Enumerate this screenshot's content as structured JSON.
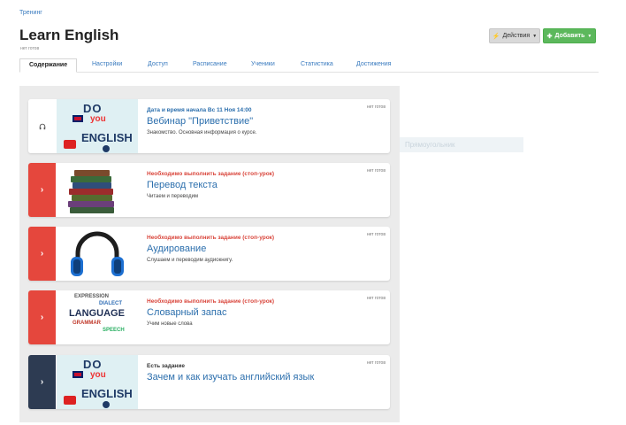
{
  "breadcrumb": "Тренинг",
  "page": {
    "title": "Learn English",
    "status": "нет готов"
  },
  "actions": {
    "actions_label": "Действия",
    "add_label": "Добавить"
  },
  "tabs": [
    {
      "label": "Содержание",
      "active": true
    },
    {
      "label": "Настройки"
    },
    {
      "label": "Доступ"
    },
    {
      "label": "Расписание"
    },
    {
      "label": "Ученики"
    },
    {
      "label": "Статистика"
    },
    {
      "label": "Достижения"
    }
  ],
  "tooltip": "Прямоугольник",
  "lessons": [
    {
      "meta": "Дата и время начала Вс 11 Ноя 14:00",
      "title": "Вебинар \"Приветствие\"",
      "desc": "Знакомство. Основная информация о курсе.",
      "status": "нет готов",
      "side": "plain",
      "thumb": "do-you-speak-english"
    },
    {
      "meta": "Необходимо выполнить задание (стоп-урок)",
      "title": "Перевод текста",
      "desc": "Читаем и переводим",
      "status": "нет готов",
      "side": "red",
      "thumb": "books"
    },
    {
      "meta": "Необходимо выполнить задание (стоп-урок)",
      "title": "Аудирование",
      "desc": "Слушаем и переводим аудиокнигу.",
      "status": "нет готов",
      "side": "red",
      "thumb": "headphones"
    },
    {
      "meta": "Необходимо выполнить задание (стоп-урок)",
      "title": "Словарный запас",
      "desc": "Учим новые слова",
      "status": "нет готов",
      "side": "red",
      "thumb": "language-words"
    },
    {
      "meta": "Есть задание",
      "title": "Зачем и как изучать английский язык",
      "desc": "",
      "status": "нет готов",
      "side": "dark",
      "thumb": "do-you-speak-english"
    }
  ],
  "thumb_text": {
    "do": "DO",
    "you": "you",
    "english": "ENGLISH",
    "language": "LANGUAGE",
    "expression": "EXPRESSION",
    "dialect": "DIALECT",
    "grammar": "GRAMMAR",
    "speech": "SPEECH"
  },
  "colors": {
    "accent_blue": "#2c6fad",
    "stop_red": "#e5473d",
    "dark_side": "#2d3b52",
    "add_green": "#5cb85c"
  }
}
